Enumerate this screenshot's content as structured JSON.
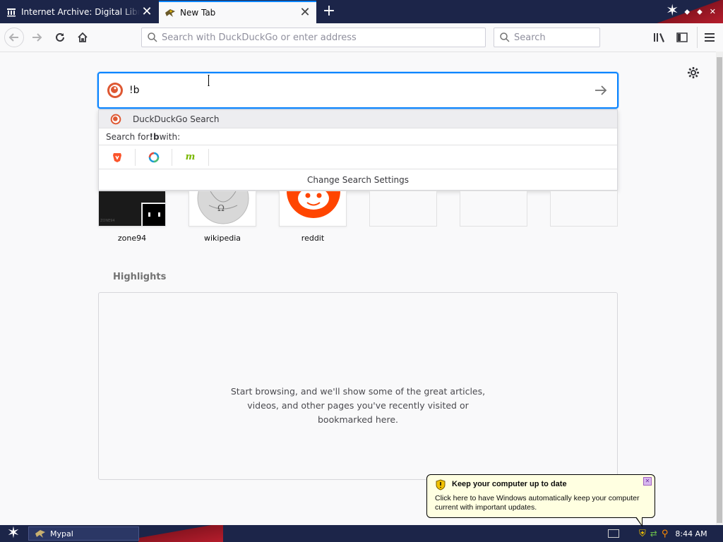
{
  "tabs": [
    {
      "label": "Internet Archive: Digital Library of Free & Borrowable Books, Movies, Music & Wayback Machine",
      "icon": "archive-icon"
    },
    {
      "label": "New Tab",
      "icon": "mypal-icon",
      "active": true
    }
  ],
  "toolbar": {
    "url_placeholder": "Search with DuckDuckGo or enter address",
    "search_placeholder": "Search"
  },
  "newtab": {
    "search_value": "!b",
    "dropdown": {
      "first_row": "DuckDuckGo Search",
      "search_for_prefix": "Search for ",
      "search_for_term": "!b",
      "search_for_suffix": " with:",
      "engines": [
        "brave-icon",
        "qwant-icon",
        "mojeek-icon"
      ],
      "change_settings": "Change Search Settings"
    },
    "top_sites": [
      {
        "label": "zone94"
      },
      {
        "label": "wikipedia"
      },
      {
        "label": "reddit"
      },
      {
        "label": ""
      },
      {
        "label": ""
      },
      {
        "label": ""
      }
    ],
    "highlights_title": "Highlights",
    "highlights_empty": "Start browsing, and we'll show some of the great articles, videos, and other pages you've recently visited or bookmarked here."
  },
  "taskbar": {
    "task_label": "Mypal",
    "clock": "8:44 AM"
  },
  "balloon": {
    "title": "Keep your computer up to date",
    "text": "Click here to have Windows automatically keep your computer current with important updates."
  },
  "colors": {
    "accent": "#0a84ff",
    "titlebar": "#1c2549",
    "flag_red": "#b51d2c"
  }
}
